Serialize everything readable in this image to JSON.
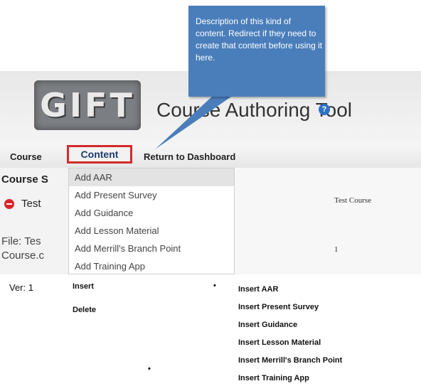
{
  "callout": {
    "text": "Description of this kind of content. Redirect if they need to create that content before using it here."
  },
  "header": {
    "logo_text": "GIFT",
    "title": "Course Authoring Tool",
    "help_glyph": "?"
  },
  "menubar": {
    "course": "Course",
    "content": "Content",
    "dashboard": "Return to Dashboard"
  },
  "sidebar": {
    "title": "Course S",
    "test": "Test",
    "file": "File: Tes",
    "file2": "Course.c"
  },
  "dropdown": {
    "items": [
      "Add AAR",
      "Add Present Survey",
      "Add Guidance",
      "Add Lesson Material",
      "Add Merrill's Branch Point",
      "Add Training App"
    ]
  },
  "fields": {
    "course_name": "Test Course",
    "number": "1"
  },
  "bottom": {
    "ver": "Ver: 1",
    "insert": "Insert",
    "delete": "Delete",
    "bullet": "•",
    "dot": "•",
    "insert_items": [
      "Insert AAR",
      "Insert Present Survey",
      "Insert Guidance",
      "Insert Lesson Material",
      "Insert Merrill's Branch Point",
      "Insert Training App"
    ]
  },
  "colors": {
    "callout": "#4a7ebb",
    "highlight_border": "#d32a2a",
    "remove_icon": "#d8252a"
  }
}
